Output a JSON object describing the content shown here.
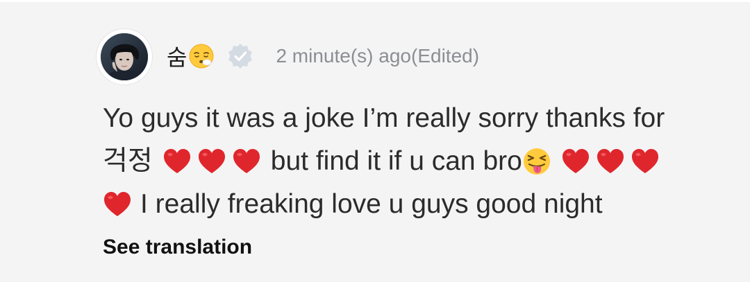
{
  "comment": {
    "username": "숨",
    "username_emoji": "face-exhaling-emoji",
    "verified_icon": "verified-badge-icon",
    "timestamp": "2 minute(s) ago(Edited)",
    "line1": "Yo guys it was a joke I’m really sorry thanks for",
    "line2_a": "걱정",
    "line2_b": "but find it if u can bro",
    "line3": "I really freaking love u guys good night",
    "see_translation": "See translation"
  },
  "colors": {
    "background": "#f4f4f4",
    "text": "#2b2b2b",
    "muted": "#8b8e93",
    "heart": "#e0262d",
    "verified": "#d5dbe3"
  }
}
